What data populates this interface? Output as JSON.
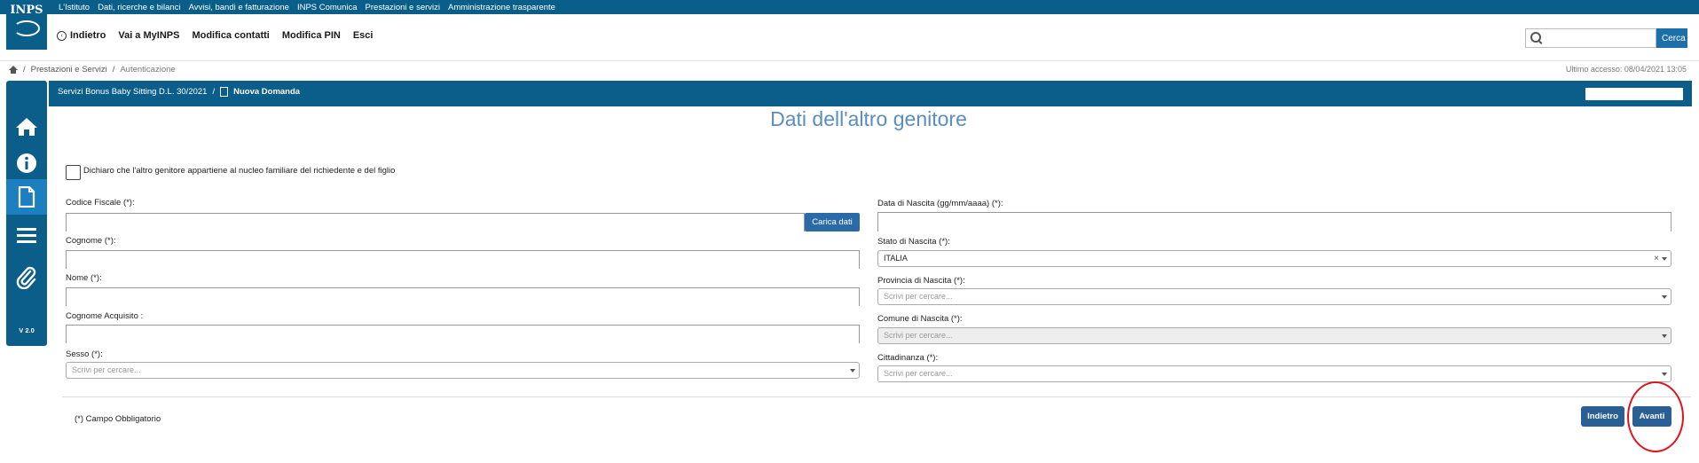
{
  "topnav": {
    "links": [
      "L'Istituto",
      "Dati, ricerche e bilanci",
      "Avvisi, bandi e fatturazione",
      "INPS Comunica",
      "Prestazioni e servizi",
      "Amministrazione trasparente"
    ]
  },
  "logo": {
    "text": "INPS"
  },
  "header": {
    "back_label": "Indietro",
    "links": [
      "Vai a MyINPS",
      "Modifica contatti",
      "Modifica PIN",
      "Esci"
    ],
    "search_placeholder": "",
    "search_button": "Cerca"
  },
  "breadcrumb": {
    "items": [
      "Prestazioni e Servizi",
      "Autenticazione"
    ],
    "last_access": "Ultimo accesso: 08/04/2021 13:05"
  },
  "sidebar": {
    "icons": [
      "home-icon",
      "info-icon",
      "document-icon",
      "menu-icon",
      "paperclip-icon"
    ],
    "version": "V 2.0"
  },
  "service_bar": {
    "service": "Servizi Bonus Baby Sitting D.L. 30/2021",
    "separator": "/",
    "page": "Nuova Domanda"
  },
  "page_title": "Dati dell'altro genitore",
  "declaration": {
    "label": "Dichiaro che l'altro genitore appartiene al nucleo familiare del richiedente e del figlio",
    "checked": false
  },
  "left_form": {
    "codice_fiscale_label": "Codice Fiscale (*):",
    "carica_button": "Carica dati",
    "cognome_label": "Cognome (*):",
    "nome_label": "Nome (*):",
    "cognome_acquisito_label": "Cognome Acquisito :",
    "sesso_label": "Sesso (*):",
    "sesso_placeholder": "Scrivi per cercare..."
  },
  "right_form": {
    "data_nascita_label": "Data di Nascita (gg/mm/aaaa) (*):",
    "stato_label": "Stato di Nascita (*):",
    "stato_value": "ITALIA",
    "provincia_label": "Provincia di Nascita (*):",
    "provincia_placeholder": "Scrivi per cercare...",
    "comune_label": "Comune di Nascita (*):",
    "comune_placeholder": "Scrivi per cercare...",
    "cittadinanza_label": "Cittadinanza (*):",
    "cittadinanza_placeholder": "Scrivi per cercare..."
  },
  "footer": {
    "required_note": "(*) Campo Obbligatorio",
    "back_button": "Indietro",
    "next_button": "Avanti"
  },
  "colors": {
    "brand": "#0b5d8a",
    "accent": "#1c7fbf",
    "highlight": "#e0141e"
  }
}
